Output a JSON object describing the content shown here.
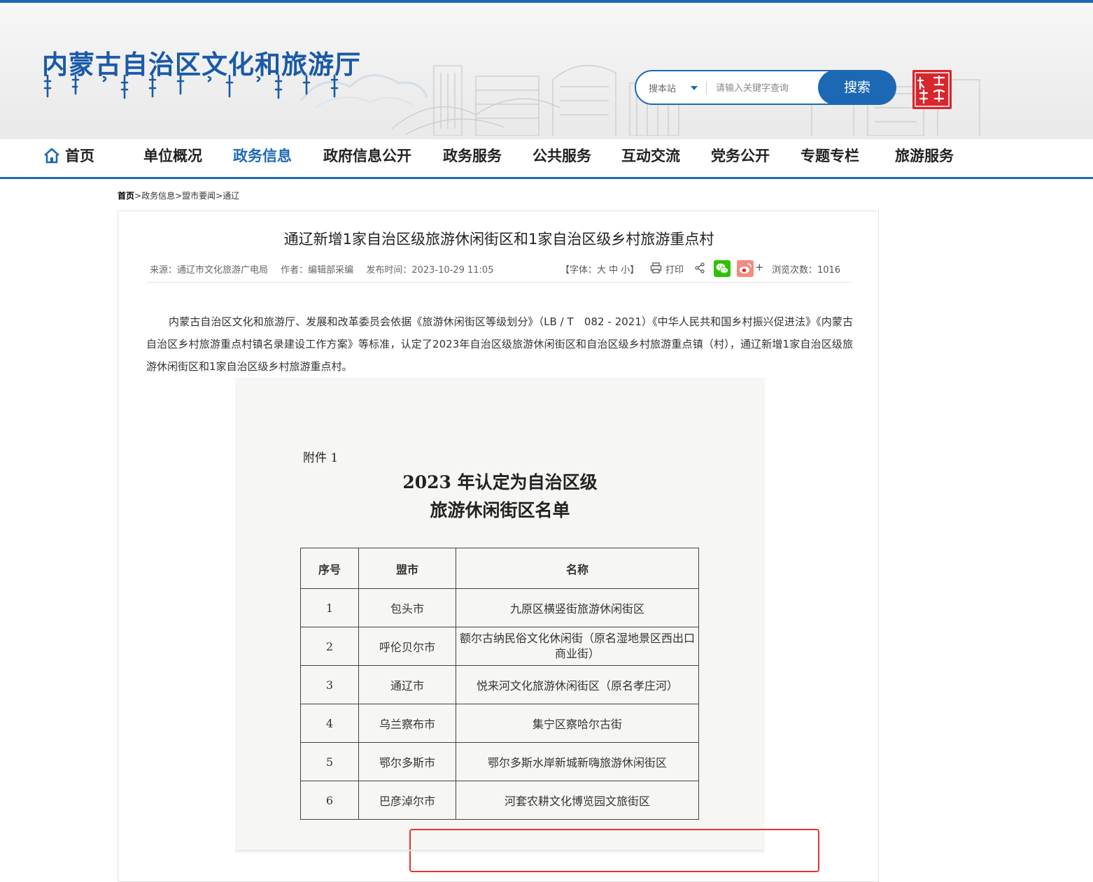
{
  "header": {
    "site_title": "内蒙古自治区文化和旅游厅",
    "search": {
      "scope_label": "搜本站",
      "placeholder": "请输入关键字查询",
      "button_label": "搜索"
    }
  },
  "nav": {
    "items": [
      "首页",
      "单位概况",
      "政务信息",
      "政府信息公开",
      "政务服务",
      "公共服务",
      "互动交流",
      "党务公开",
      "专题专栏",
      "旅游服务"
    ],
    "active": "政务信息"
  },
  "breadcrumb": {
    "items": [
      "首页",
      "政务信息",
      "盟市要闻",
      "通辽"
    ],
    "separator": ">"
  },
  "article": {
    "title": "通辽新增1家自治区级旅游休闲街区和1家自治区级乡村旅游重点村",
    "meta": {
      "source": "来源：通辽市文化旅游广电局",
      "author": "作者：编辑部采编",
      "published": "发布时间：2023-10-29 11:05"
    },
    "tools": {
      "font_size": "【字体：大 中 小】",
      "print": "打印",
      "plus": "+",
      "views": "浏览次数：1016"
    },
    "paragraph": "内蒙古自治区文化和旅游厅、发展和改革委员会依据《旅游休闲街区等级划分》（LB / T　082 - 2021）《中华人民共和国乡村振兴促进法》《内蒙古自治区乡村旅游重点村镇名录建设工作方案》等标准，认定了2023年自治区级旅游休闲街区和自治区级乡村旅游重点镇（村），通辽新增1家自治区级旅游休闲街区和1家自治区级乡村旅游重点村。",
    "document": {
      "annex": "附件 1",
      "title_line1": "2023 年认定为自治区级",
      "title_line2": "旅游休闲街区名单",
      "columns": [
        "序号",
        "盟市",
        "名称"
      ],
      "rows": [
        [
          "1",
          "包头市",
          "九原区横竖街旅游休闲街区"
        ],
        [
          "2",
          "呼伦贝尔市",
          "额尔古纳民俗文化休闲街（原名湿地景区西出口商业街）"
        ],
        [
          "3",
          "通辽市",
          "悦来河文化旅游休闲街区（原名孝庄河）"
        ],
        [
          "4",
          "乌兰察布市",
          "集宁区察哈尔古街"
        ],
        [
          "5",
          "鄂尔多斯市",
          "鄂尔多斯水岸新城新嗨旅游休闲街区"
        ],
        [
          "6",
          "巴彦淖尔市",
          "河套农耕文化博览园文旅街区"
        ]
      ],
      "highlighted_row": "3"
    }
  },
  "colors": {
    "brand_blue": "#1d68b4",
    "title_blue": "#1a5aa8",
    "highlight_red": "#e53333",
    "wechat_green": "#2dc100",
    "weibo_red": "#e6162d"
  },
  "icons": [
    "home-icon",
    "print-icon",
    "share-icon",
    "wechat-icon",
    "weibo-icon",
    "seal-logo"
  ]
}
